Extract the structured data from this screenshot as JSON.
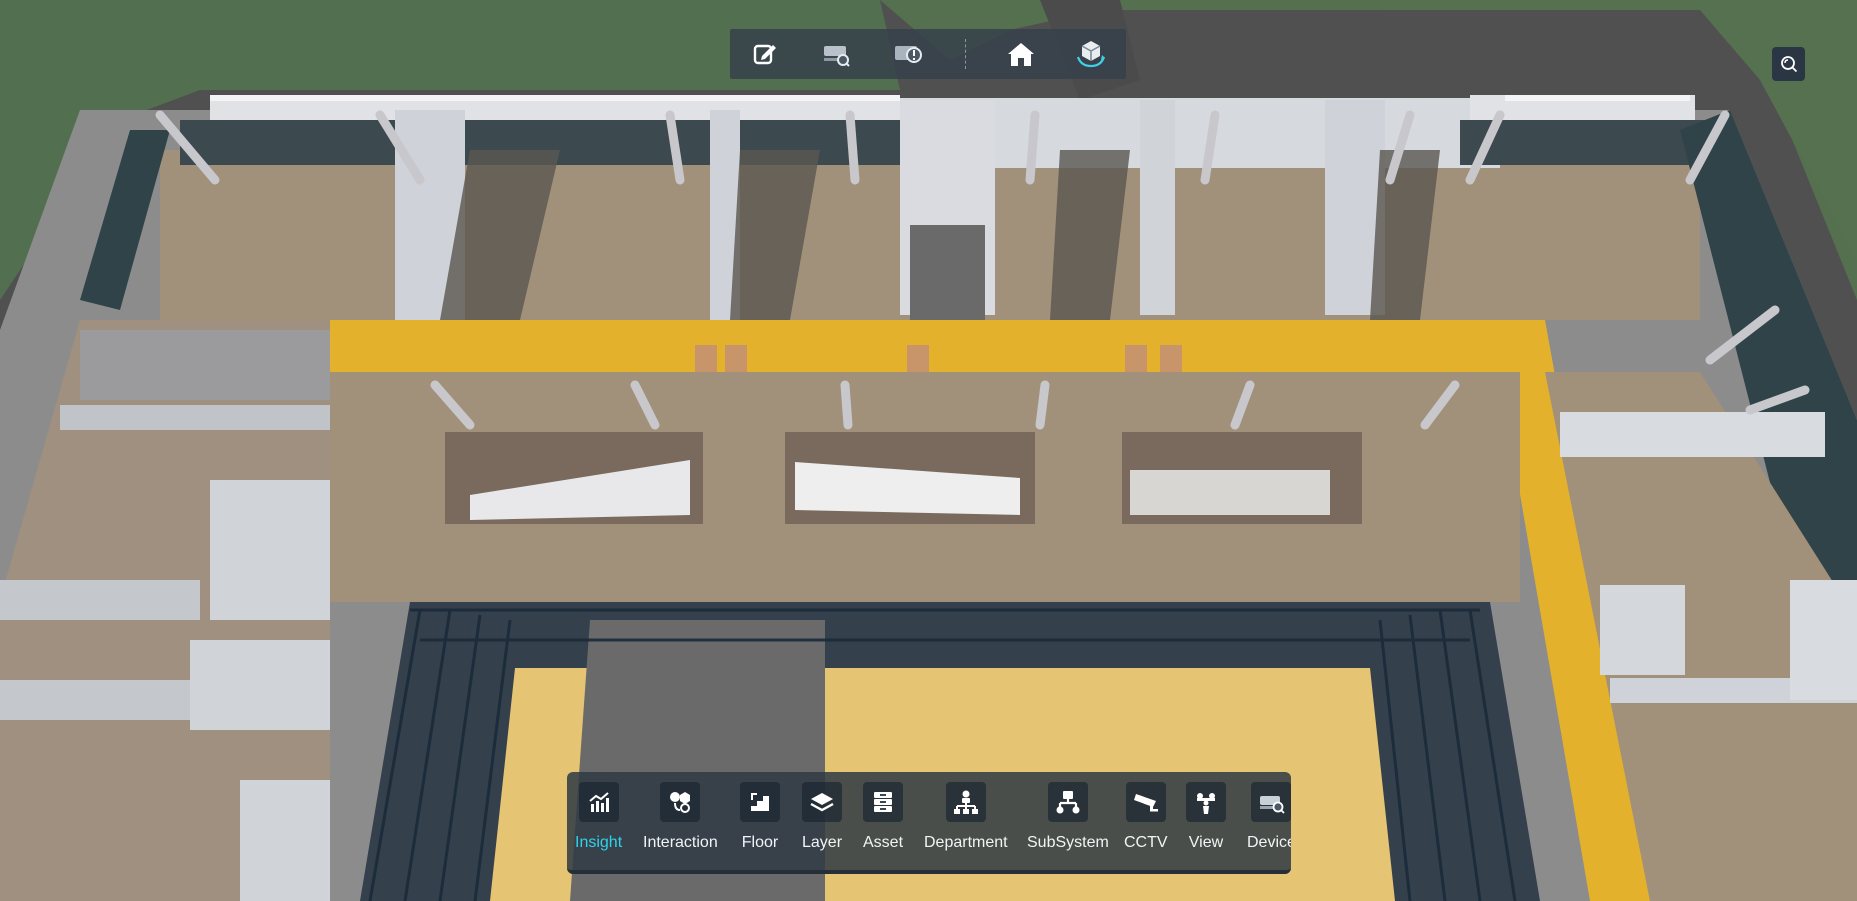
{
  "toolbar": {
    "buttons": [
      {
        "icon": "edit-icon"
      },
      {
        "icon": "device-search-icon"
      },
      {
        "icon": "device-alert-icon"
      },
      {
        "icon": "home-icon"
      },
      {
        "icon": "rotate-3d-icon"
      }
    ]
  },
  "zoom_button": {
    "icon": "zoom-search-icon"
  },
  "dock": {
    "active": "Insight",
    "accent_color": "#2fd2ea",
    "items": [
      {
        "label": "Insight",
        "icon": "chart-icon"
      },
      {
        "label": "Interaction",
        "icon": "interaction-icon"
      },
      {
        "label": "Floor",
        "icon": "floor-icon"
      },
      {
        "label": "Layer",
        "icon": "layer-icon"
      },
      {
        "label": "Asset",
        "icon": "asset-icon"
      },
      {
        "label": "Department",
        "icon": "department-icon"
      },
      {
        "label": "SubSystem",
        "icon": "subsystem-icon"
      },
      {
        "label": "CCTV",
        "icon": "cctv-icon"
      },
      {
        "label": "View",
        "icon": "view-icon"
      },
      {
        "label": "Device",
        "icon": "device-icon"
      }
    ]
  },
  "colors": {
    "corridor_yellow": "#e3b12b",
    "floor_tan": "#a2917a",
    "grass": "#4f6b4c",
    "courtyard": "#e5c473"
  }
}
